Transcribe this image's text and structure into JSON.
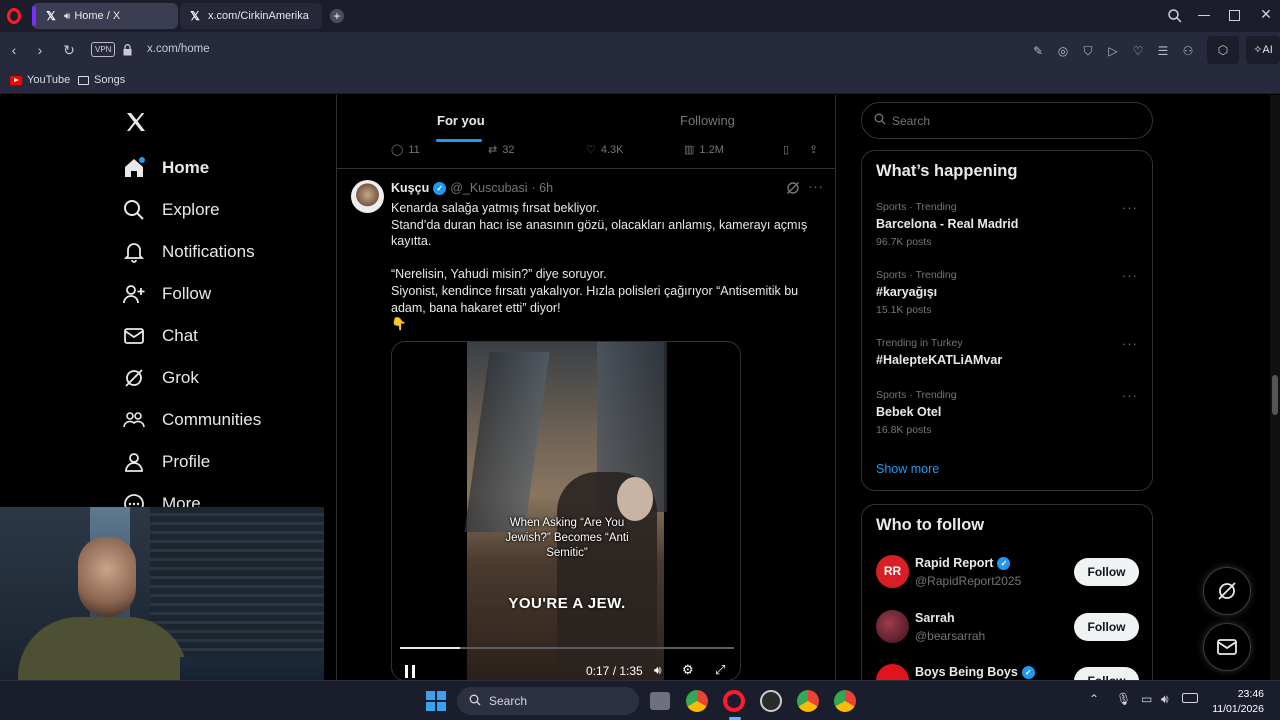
{
  "browser": {
    "tabs": [
      {
        "label": "Home / X",
        "active": true
      },
      {
        "label": "x.com/CirkinAmerika",
        "active": false
      }
    ],
    "vpn_label": "VPN",
    "url": "x.com/home",
    "ai_label": "AI",
    "bookmarks": [
      {
        "label": "YouTube",
        "icon": "youtube-icon"
      },
      {
        "label": "Songs",
        "icon": "folder-icon"
      }
    ]
  },
  "sidebar": {
    "items": [
      {
        "label": "Home",
        "icon": "home-icon",
        "active": true
      },
      {
        "label": "Explore",
        "icon": "search-icon"
      },
      {
        "label": "Notifications",
        "icon": "bell-icon"
      },
      {
        "label": "Follow",
        "icon": "person-plus-icon"
      },
      {
        "label": "Chat",
        "icon": "mail-icon"
      },
      {
        "label": "Grok",
        "icon": "grok-icon"
      },
      {
        "label": "Communities",
        "icon": "people-icon"
      },
      {
        "label": "Profile",
        "icon": "person-icon"
      },
      {
        "label": "More",
        "icon": "more-circle-icon"
      }
    ]
  },
  "feed": {
    "tabs": [
      {
        "label": "For you",
        "active": true
      },
      {
        "label": "Following",
        "active": false
      }
    ],
    "prev_actions": {
      "replies": "11",
      "reposts": "32",
      "likes": "4.3K",
      "views": "1.2M"
    },
    "tweet": {
      "name": "Kuşçu",
      "handle": "@_Kuscubasi",
      "time": "· 6h",
      "lines": [
        "Kenarda salağa yatmış fırsat bekliyor.",
        "Stand’da duran hacı ise anasının gözü, olacakları anlamış, kamerayı açmış kayıtta.",
        "",
        "“Nerelisin, Yahudi misin?” diye soruyor.",
        "Siyonist, kendince fırsatı yakalıyor. Hızla polisleri çağırıyor “Antisemitik bu adam, bana hakaret etti” diyor!",
        "👇"
      ],
      "video": {
        "caption": "When Asking “Are You Jewish?” Becomes “Anti Semitic”",
        "subtitle": "YOU'RE A JEW.",
        "time": "0:17 / 1:35",
        "progress": 0.18
      }
    }
  },
  "right": {
    "search_placeholder": "Search",
    "whats_happening": {
      "title": "What’s happening",
      "trends": [
        {
          "meta": "Sports · Trending",
          "name": "Barcelona - Real Madrid",
          "count": "96.7K posts"
        },
        {
          "meta": "Sports · Trending",
          "name": "#karyağışı",
          "count": "15.1K posts"
        },
        {
          "meta": "Trending in Turkey",
          "name": "#HaleptеKATLiAMvar",
          "count": ""
        },
        {
          "meta": "Sports · Trending",
          "name": "Bebek Otel",
          "count": "16.8K posts"
        }
      ],
      "show_more": "Show more"
    },
    "who_to_follow": {
      "title": "Who to follow",
      "accounts": [
        {
          "name": "Rapid Report",
          "handle": "@RapidReport2025",
          "verified": true,
          "avatar_text": "RR",
          "button": "Follow"
        },
        {
          "name": "Sarrah",
          "handle": "@bearsarrah",
          "verified": false,
          "avatar_text": "",
          "button": "Follow"
        },
        {
          "name": "Boys Being Boys",
          "handle": "",
          "verified": true,
          "avatar_text": "",
          "button": "Follow"
        }
      ]
    }
  },
  "taskbar": {
    "search_label": "Search",
    "time": "23:46",
    "date": "11/01/2026"
  },
  "colors": {
    "accent": "#1d9bf0",
    "background": "#000000",
    "border": "#2f3336",
    "muted": "#71767b"
  }
}
